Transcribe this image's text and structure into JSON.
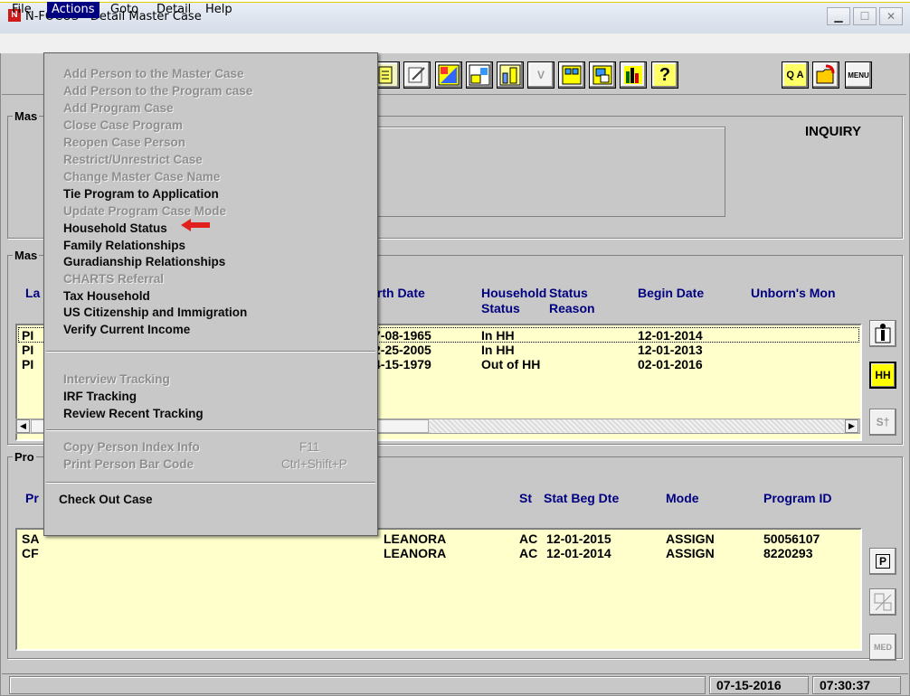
{
  "window": {
    "title": "N-FOCUS - Detail Master Case",
    "app_icon": "N",
    "mode_label": "INQUIRY"
  },
  "menubar": [
    "File",
    "Actions",
    "Goto",
    "Detail",
    "Help"
  ],
  "actions_menu": {
    "group1": [
      {
        "label": "Add Person to the Master Case",
        "enabled": false
      },
      {
        "label": "Add Person to the Program case",
        "enabled": false
      },
      {
        "label": "Add Program Case",
        "enabled": false
      },
      {
        "label": "Close Case Program",
        "enabled": false
      },
      {
        "label": "Reopen Case Person",
        "enabled": false
      },
      {
        "label": "Restrict/Unrestrict Case",
        "enabled": false
      },
      {
        "label": "Change Master Case Name",
        "enabled": false
      },
      {
        "label": "Tie Program to Application",
        "enabled": true
      },
      {
        "label": "Update Program Case Mode",
        "enabled": false
      },
      {
        "label": "Household Status",
        "enabled": true
      },
      {
        "label": "Family Relationships",
        "enabled": true
      },
      {
        "label": "Guradianship Relationships",
        "enabled": true
      },
      {
        "label": "CHARTS Referral",
        "enabled": false
      },
      {
        "label": "Tax Household",
        "enabled": true
      },
      {
        "label": "US Citizenship and Immigration",
        "enabled": true
      },
      {
        "label": "Verify Current Income",
        "enabled": true
      }
    ],
    "group2": [
      {
        "label": "Interview Tracking",
        "enabled": false
      },
      {
        "label": "IRF Tracking",
        "enabled": true
      },
      {
        "label": "Review Recent Tracking",
        "enabled": true
      }
    ],
    "group3": [
      {
        "label": "Copy Person Index Info",
        "shortcut": "F11",
        "enabled": false
      },
      {
        "label": "Print Person Bar Code",
        "shortcut": "Ctrl+Shift+P",
        "enabled": false
      }
    ],
    "group4": [
      {
        "label": "Check Out Case",
        "enabled": true
      }
    ],
    "highlight_arrow_color": "#e0201c"
  },
  "sections": {
    "master_case_prefix": "Mas",
    "master_people_prefix": "Mas",
    "program_prefix": "Pro"
  },
  "persons_table": {
    "headers": {
      "last": "La",
      "birth_date": "irth Date",
      "household_status": "Household Status",
      "status_reason": "Status Reason",
      "begin_date": "Begin Date",
      "unborn": "Unborn's Mon"
    },
    "rows": [
      {
        "last": "PI",
        "birth": "7-08-1965",
        "hh": "In HH",
        "begin": "12-01-2014"
      },
      {
        "last": "PI",
        "birth": "2-25-2005",
        "hh": "In HH",
        "begin": "12-01-2013"
      },
      {
        "last": "PI",
        "birth": "4-15-1979",
        "hh": "Out of HH",
        "begin": "02-01-2016"
      }
    ]
  },
  "programs_table": {
    "headers": {
      "pr": "Pr",
      "st": "St",
      "stat_beg": "Stat Beg Dte",
      "mode": "Mode",
      "program_id": "Program ID"
    },
    "rows": [
      {
        "pr": "SA",
        "name": "LEANORA",
        "st": "AC",
        "stat_beg": "12-01-2015",
        "mode": "ASSIGN",
        "program_id": "50056107"
      },
      {
        "pr": "CF",
        "name": "LEANORA",
        "st": "AC",
        "stat_beg": "12-01-2014",
        "mode": "ASSIGN",
        "program_id": "8220293"
      }
    ]
  },
  "sidebuttons": {
    "hh": "HH",
    "p": "P",
    "med": "MED"
  },
  "toolbar": {
    "qa_label": "Q A",
    "menu_label": "MENU",
    "help_label": "?"
  },
  "status": {
    "date": "07-15-2016",
    "time": "07:30:37"
  }
}
